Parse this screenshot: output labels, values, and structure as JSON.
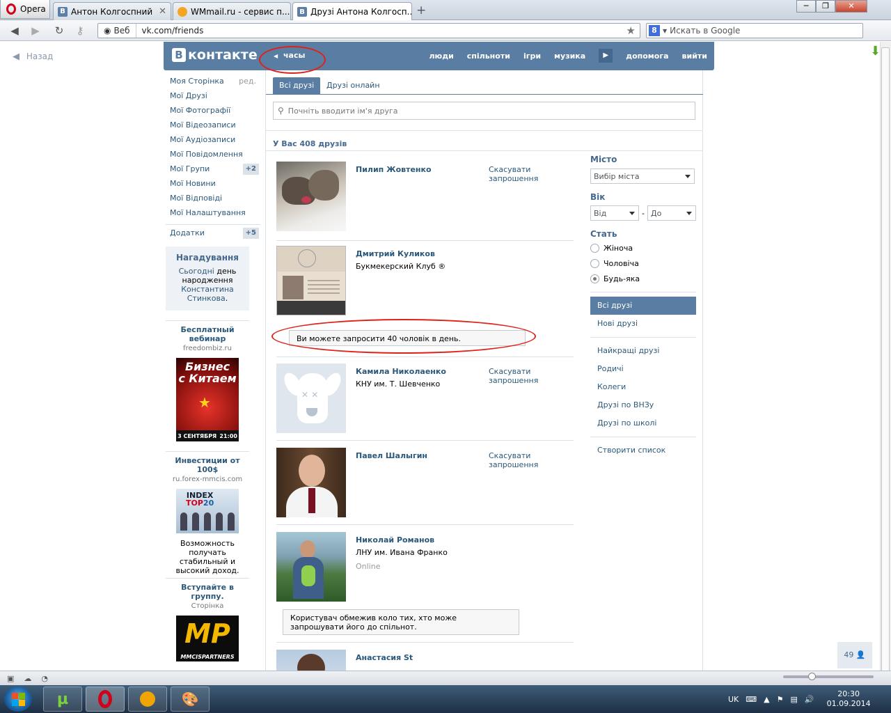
{
  "browser": {
    "menu_label": "Opera",
    "tabs": [
      {
        "label": "Антон Колгоспний",
        "favicon": "В"
      },
      {
        "label": "WMmail.ru - сервис п...",
        "favicon": ""
      },
      {
        "label": "Друзі Антона Колгосп...",
        "favicon": "В"
      }
    ],
    "address": {
      "scheme_label": "Веб",
      "url": "vk.com/friends"
    },
    "search_placeholder": "Искать в Google",
    "search_engine_letter": "8"
  },
  "back_link": "Назад",
  "vk": {
    "logo_text": "контакте",
    "logo_letter": "В",
    "player_label": "часы",
    "topnav": [
      "люди",
      "спільноти",
      "ігри",
      "музика",
      "допомога",
      "вийти"
    ],
    "left_menu": [
      {
        "label": "Моя Сторінка",
        "extra": "ред."
      },
      {
        "label": "Мої Друзі"
      },
      {
        "label": "Мої Фотографії"
      },
      {
        "label": "Мої Відеозаписи"
      },
      {
        "label": "Мої Аудіозаписи"
      },
      {
        "label": "Мої Повідомлення"
      },
      {
        "label": "Мої Групи",
        "badge": "+2"
      },
      {
        "label": "Мої Новини"
      },
      {
        "label": "Мої Відповіді"
      },
      {
        "label": "Мої Налаштування"
      },
      {
        "label": "Додатки",
        "badge": "+5"
      }
    ],
    "reminder": {
      "title": "Нагадування",
      "link1": "Сьогодні",
      "text1": "день народження",
      "link2": "Константина Стинкова",
      "end": "."
    },
    "ads": [
      {
        "title": "Бесплатный вебинар",
        "domain": "freedombiz.ru",
        "banner_line1": "Бизнес",
        "banner_line2": "с Китаем",
        "banner_date": "3 СЕНТЯБРЯ",
        "banner_time": "21:00"
      },
      {
        "title": "Инвестиции от 100$",
        "domain": "ru.forex-mmcis.com",
        "banner_index": "INDEX",
        "banner_top": "TOP",
        "banner_num": "20",
        "description": "Возможность получать стабильный и высокий доход."
      },
      {
        "title": "Вступайте в группу.",
        "domain": "Сторінка",
        "banner_text": "MP",
        "banner_sub": "MMCISPARTNERS"
      }
    ],
    "tabs": [
      "Всі друзі",
      "Друзі онлайн"
    ],
    "search_placeholder": "Почніть вводити ім'я друга",
    "friends_count": "У Вас 408 друзів",
    "friends": [
      {
        "name": "Пилип Жовтенко",
        "sub": "",
        "online": "",
        "action": "Скасувати запрошення"
      },
      {
        "name": "Дмитрий Куликов",
        "sub": "Букмекерский Клуб ®",
        "online": "",
        "action": ""
      },
      {
        "name": "Камила Николаенко",
        "sub": "КНУ им. Т. Шевченко",
        "online": "",
        "action": "Скасувати запрошення"
      },
      {
        "name": "Павел Шалыгин",
        "sub": "",
        "online": "",
        "action": "Скасувати запрошення"
      },
      {
        "name": "Николай Романов",
        "sub": "ЛНУ им. Ивана Франко",
        "online": "Online",
        "action": ""
      },
      {
        "name": "Анастасия St",
        "sub": "",
        "online": "",
        "action": ""
      }
    ],
    "notice_invites": "Ви можете запросити 40 чоловік в день.",
    "notice_restricted": "Користувач обмежив коло тих, хто може запрошувати його до спільнот.",
    "filters": {
      "city_label": "Місто",
      "city_value": "Вибір міста",
      "age_label": "Вік",
      "age_from": "Від",
      "age_dash": "-",
      "age_to": "До",
      "gender_label": "Стать",
      "genders": [
        "Жіноча",
        "Чоловіча",
        "Будь-яка"
      ],
      "gender_selected": 2,
      "lists1": [
        "Всі друзі",
        "Нові друзі"
      ],
      "lists2": [
        "Найкращі друзі",
        "Родичі",
        "Колеги",
        "Друзі по ВНЗу",
        "Друзі по школі"
      ],
      "create_list": "Створити список"
    },
    "online_count": "49"
  },
  "taskbar": {
    "lang": "UK",
    "time": "20:30",
    "date": "01.09.2014"
  },
  "colors": {
    "vk_blue": "#597da3",
    "vk_link": "#2b587a",
    "annotation_red": "#e0201a"
  }
}
